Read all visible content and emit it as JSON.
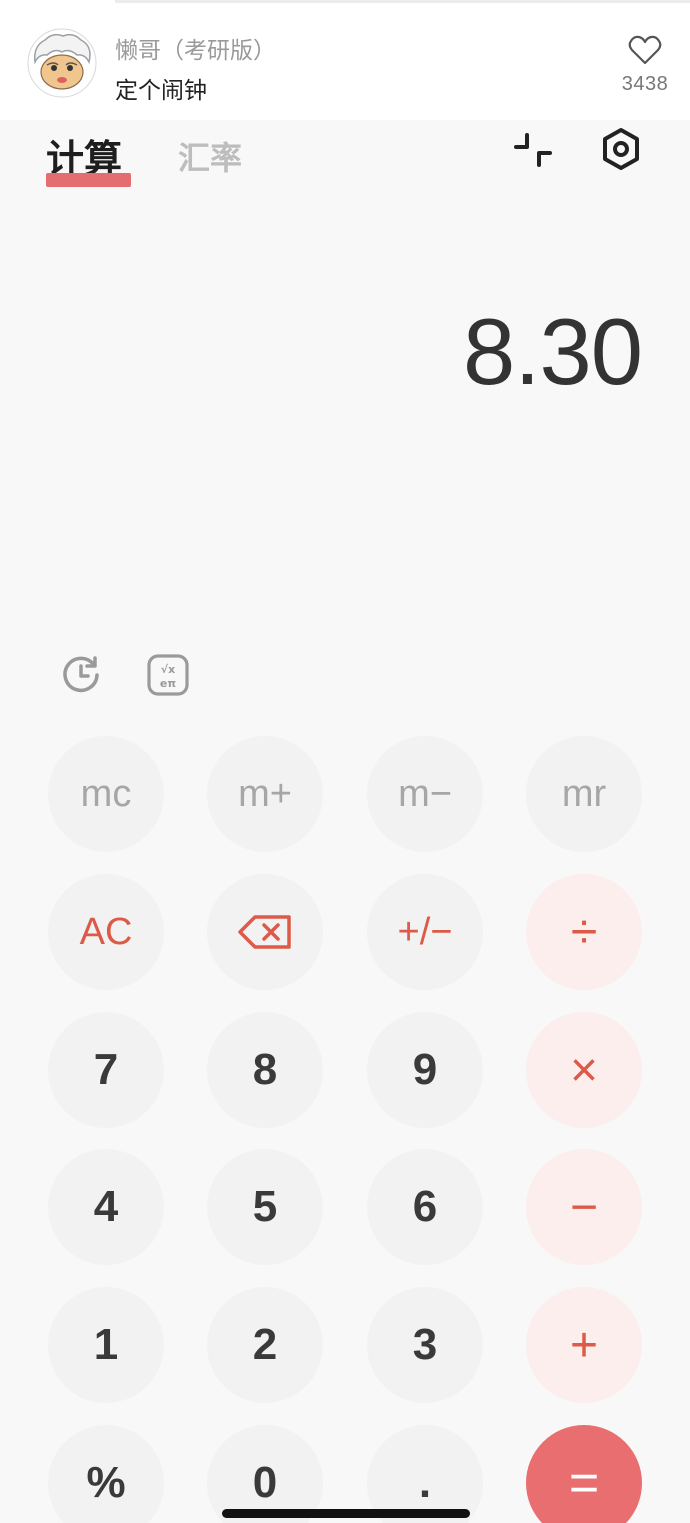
{
  "post": {
    "username": "懒哥（考研版）",
    "text": "定个闹钟",
    "like_count": "3438"
  },
  "calculator": {
    "tabs": [
      "计算",
      "汇率"
    ],
    "display_value": "8.30",
    "accent_color": "#e86e6f",
    "keys": {
      "row1": [
        "mc",
        "m+",
        "m−",
        "mr"
      ],
      "row2": [
        "AC",
        "backspace",
        "+/−",
        "÷"
      ],
      "row3": [
        "7",
        "8",
        "9",
        "×"
      ],
      "row4": [
        "4",
        "5",
        "6",
        "−"
      ],
      "row5": [
        "1",
        "2",
        "3",
        "+"
      ],
      "row6": [
        "%",
        "0",
        ".",
        "="
      ]
    }
  }
}
